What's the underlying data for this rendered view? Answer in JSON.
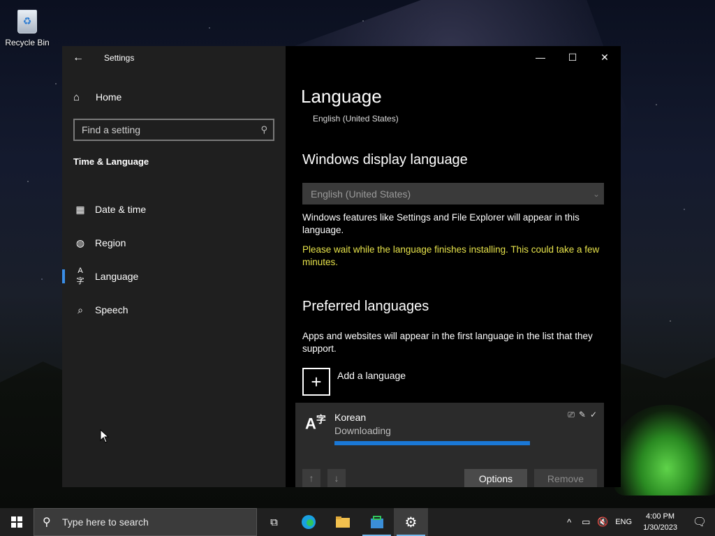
{
  "desktop": {
    "icons": [
      {
        "label": "Recycle Bin",
        "icon": "recycle-bin-icon"
      }
    ]
  },
  "window": {
    "app_title": "Settings",
    "back_icon": "back-arrow-icon",
    "controls": {
      "minimize": "—",
      "maximize": "☐",
      "close": "✕"
    }
  },
  "sidebar": {
    "home_label": "Home",
    "search_placeholder": "Find a setting",
    "section_header": "Time & Language",
    "items": [
      {
        "label": "Date & time",
        "icon": "calendar-clock-icon",
        "glyph": "📅",
        "active": false
      },
      {
        "label": "Region",
        "icon": "globe-icon",
        "glyph": "🌐",
        "active": false
      },
      {
        "label": "Language",
        "icon": "language-icon",
        "glyph": "A字",
        "active": true
      },
      {
        "label": "Speech",
        "icon": "microphone-icon",
        "glyph": "🎙",
        "active": false
      }
    ]
  },
  "main": {
    "title": "Language",
    "subtitle": "English (United States)",
    "display_language": {
      "heading": "Windows display language",
      "selected": "English (United States)",
      "description": "Windows features like Settings and File Explorer will appear in this language.",
      "warning": "Please wait while the language finishes installing. This could take a few minutes."
    },
    "preferred": {
      "heading": "Preferred languages",
      "description": "Apps and websites will appear in the first language in the list that they support.",
      "add_label": "Add a language",
      "languages": [
        {
          "name": "Korean",
          "status": "Downloading",
          "progress": 1.0,
          "feature_icons": [
            "display-language-icon",
            "handwriting-icon",
            "spellcheck-icon"
          ],
          "options_label": "Options",
          "remove_label": "Remove"
        }
      ]
    }
  },
  "taskbar": {
    "search_placeholder": "Type here to search",
    "apps": [
      {
        "name": "task-view",
        "icon": "task-view-icon"
      },
      {
        "name": "edge",
        "icon": "edge-icon"
      },
      {
        "name": "file-explorer",
        "icon": "folder-icon"
      },
      {
        "name": "store",
        "icon": "store-icon"
      },
      {
        "name": "settings",
        "icon": "gear-icon"
      }
    ],
    "tray": {
      "language": "ENG",
      "time": "4:00 PM",
      "date": "1/30/2023"
    }
  },
  "colors": {
    "accent": "#1a78d6",
    "warning_text": "#e6e24a",
    "sidebar_bg": "#1f1f1f",
    "card_bg": "#2b2b2b"
  }
}
